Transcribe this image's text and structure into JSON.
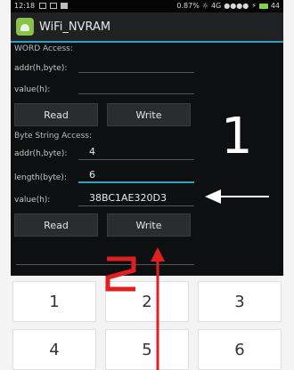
{
  "statusbar": {
    "time": "12:18",
    "network": "0.87%",
    "signal": "4G",
    "battery": "44"
  },
  "app": {
    "title": "WiFi_NVRAM"
  },
  "word_access": {
    "section": "WORD Access:",
    "addr_label": "addr(h,byte):",
    "addr_value": "",
    "value_label": "value(h):",
    "value_value": "",
    "read_label": "Read",
    "write_label": "Write"
  },
  "byte_access": {
    "section": "Byte String Access:",
    "addr_label": "addr(h,byte):",
    "addr_value": "4",
    "length_label": "length(byte):",
    "length_value": "6",
    "value_label": "value(h):",
    "value_value": "38BC1AE320D3",
    "read_label": "Read",
    "write_label": "Write"
  },
  "annotations": {
    "one": "1",
    "two": "2"
  },
  "keypad": {
    "keys": [
      "1",
      "2",
      "3",
      "4",
      "5",
      "6"
    ]
  },
  "colors": {
    "accent": "#30a0c8",
    "annotation": "#e02020"
  }
}
